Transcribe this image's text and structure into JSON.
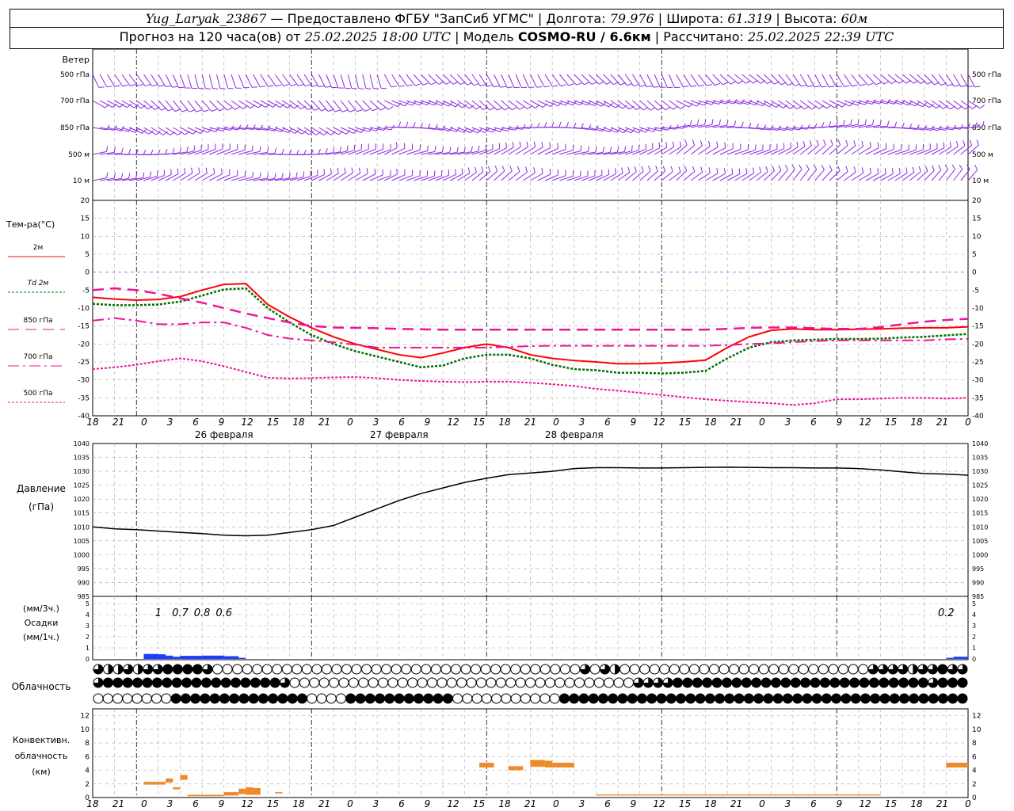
{
  "header": {
    "station": "Yug_Laryak_23867",
    "provider": "— Предоставлено ФГБУ \"ЗапСиб УГМС\"",
    "lon_label": "Долгота:",
    "lon": "79.976",
    "lat_label": "Широта:",
    "lat": "61.319",
    "alt_label": "Высота:",
    "alt": "60м",
    "forecast_label": "Прогноз на 120 часа(ов) от",
    "forecast_time": "25.02.2025 18:00 UTC",
    "model_label": "Модель",
    "model": "COSMO-RU / 6.6км",
    "calc_label": "Рассчитано:",
    "calc_time": "25.02.2025 22:39 UTC"
  },
  "labels": {
    "wind": "Ветер",
    "wind_levels": [
      "500 гПа",
      "700 гПа",
      "850 гПа",
      "500 м",
      "10 м"
    ],
    "temp_title": "Тем-ра(°С)",
    "legend": [
      {
        "label": "2м",
        "color": "#ff0000"
      },
      {
        "label": "Td 2м",
        "color": "#007000"
      },
      {
        "label": "850 гПа",
        "color": "#ee1493"
      },
      {
        "label": "700 гПа",
        "color": "#ee1493"
      },
      {
        "label": "500 гПа",
        "color": "#ee1493"
      }
    ],
    "pressure_title": "Давление",
    "pressure_unit": "(гПа)",
    "precip_unit_3h": "(мм/3ч.)",
    "precip_title": "Осадки",
    "precip_unit_1h": "(мм/1ч.)",
    "cloud_title": "Облачность",
    "conv_title1": "Конвективн.",
    "conv_title2": "облачность",
    "conv_unit": "(км)",
    "day_labels": [
      "26 февраля",
      "27 февраля",
      "28 февраля"
    ]
  },
  "chart_data": [
    {
      "type": "line",
      "title": "Тем-ра(°С)",
      "x_hours": [
        0,
        3,
        6,
        9,
        12,
        15,
        18,
        21,
        24,
        27,
        30,
        33,
        36,
        39,
        42,
        45,
        48,
        51,
        54,
        57,
        60,
        63,
        66,
        69,
        72,
        75,
        78,
        81,
        84,
        87,
        90,
        93,
        96,
        99,
        102,
        105,
        108,
        111,
        114,
        117,
        120
      ],
      "xticks": [
        "18",
        "21",
        "0",
        "3",
        "6",
        "9",
        "12",
        "15",
        "18",
        "21",
        "0",
        "3",
        "6",
        "9",
        "12",
        "15",
        "18",
        "21",
        "0",
        "3",
        "6",
        "9",
        "12",
        "15",
        "18",
        "21",
        "0",
        "3",
        "6",
        "9",
        "12",
        "15",
        "18",
        "21",
        "0"
      ],
      "ylim": [
        -40,
        20
      ],
      "yticks": [
        -40,
        -35,
        -30,
        -25,
        -20,
        -15,
        -10,
        -5,
        0,
        5,
        10,
        15,
        20
      ],
      "series": [
        {
          "name": "2м",
          "color": "#ff0000",
          "values": [
            -7,
            -7.5,
            -7.8,
            -7.6,
            -6.8,
            -5,
            -3.4,
            -3.2,
            -9,
            -12.5,
            -15.5,
            -18,
            -20,
            -21.5,
            -23,
            -23.8,
            -22.5,
            -21,
            -20,
            -21,
            -23,
            -24,
            -24.6,
            -25,
            -25.5,
            -25.5,
            -25.3,
            -25,
            -24.5,
            -21,
            -18,
            -16.2,
            -15.8,
            -16,
            -16,
            -15.9,
            -15.8,
            -15.6,
            -15.5,
            -15.5,
            -15.2
          ]
        },
        {
          "name": "Td 2м",
          "color": "#007000",
          "values": [
            -8.8,
            -9.2,
            -9.2,
            -9.0,
            -8.2,
            -6.5,
            -4.8,
            -4.5,
            -10,
            -14,
            -17.5,
            -20,
            -22,
            -23.5,
            -25,
            -26.5,
            -26,
            -24,
            -23,
            -23,
            -24,
            -25.8,
            -27,
            -27.3,
            -28,
            -28,
            -28.2,
            -28,
            -27.5,
            -24,
            -21,
            -19.5,
            -19,
            -18.8,
            -18.6,
            -18.6,
            -18.5,
            -18.2,
            -18,
            -17.6,
            -17.2
          ]
        },
        {
          "name": "850 гПа",
          "color": "#ee1493",
          "values": [
            -5,
            -4.5,
            -5,
            -6,
            -7.3,
            -8.5,
            -10,
            -11.5,
            -12.8,
            -14,
            -15,
            -15.4,
            -15.5,
            -15.6,
            -15.8,
            -15.9,
            -16,
            -16,
            -16,
            -16,
            -16,
            -16,
            -16,
            -16,
            -16,
            -16,
            -16,
            -16,
            -16,
            -15.8,
            -15.5,
            -15.4,
            -15.4,
            -15.6,
            -15.8,
            -15.8,
            -15.3,
            -14.5,
            -13.8,
            -13.3,
            -13
          ]
        },
        {
          "name": "700 гПа",
          "color": "#ee1493",
          "values": [
            -13.5,
            -12.8,
            -13.5,
            -14.5,
            -14.5,
            -14,
            -14,
            -15.5,
            -17.5,
            -18.5,
            -19,
            -19.5,
            -20.2,
            -21,
            -21,
            -21,
            -21,
            -21,
            -21,
            -20.8,
            -20.6,
            -20.5,
            -20.5,
            -20.5,
            -20.5,
            -20.5,
            -20.5,
            -20.5,
            -20.5,
            -20.3,
            -20,
            -19.8,
            -19.5,
            -19.2,
            -19,
            -19,
            -19,
            -19,
            -19,
            -18.7,
            -18.6
          ]
        },
        {
          "name": "500 гПа",
          "color": "#ee1493",
          "values": [
            -27,
            -26.5,
            -25.8,
            -24.8,
            -24,
            -24.8,
            -26.2,
            -27.8,
            -29.4,
            -29.6,
            -29.5,
            -29.3,
            -29.2,
            -29.5,
            -30,
            -30.3,
            -30.5,
            -30.6,
            -30.5,
            -30.5,
            -30.8,
            -31.2,
            -31.7,
            -32.5,
            -33,
            -33.6,
            -34.2,
            -34.8,
            -35.4,
            -35.8,
            -36.2,
            -36.5,
            -37,
            -36.5,
            -35.4,
            -35.4,
            -35.2,
            -35,
            -35,
            -35.2,
            -35
          ]
        }
      ]
    },
    {
      "type": "line",
      "title": "Давление",
      "ylabel": "(гПа)",
      "ylim": [
        985,
        1040
      ],
      "yticks": [
        985,
        990,
        995,
        1000,
        1005,
        1010,
        1015,
        1020,
        1025,
        1030,
        1035,
        1040
      ],
      "series": [
        {
          "name": "",
          "color": "#000000",
          "values": [
            1010,
            1009.3,
            1009,
            1008.5,
            1008,
            1007.6,
            1007,
            1006.8,
            1007,
            1008,
            1009,
            1010.5,
            1013.5,
            1016.5,
            1019.5,
            1022,
            1024,
            1026,
            1027.5,
            1028.8,
            1029.4,
            1030,
            1031,
            1031.3,
            1031.3,
            1031.2,
            1031.2,
            1031.3,
            1031.4,
            1031.5,
            1031.4,
            1031.3,
            1031.3,
            1031.2,
            1031.2,
            1031,
            1030.5,
            1029.8,
            1029.2,
            1029,
            1028.6
          ]
        }
      ]
    },
    {
      "type": "bar",
      "title": "Осадки",
      "ylim": [
        0,
        5
      ],
      "yticks": [
        0,
        1,
        2,
        3,
        4,
        5
      ],
      "labels_3h": [
        {
          "hour": 9,
          "text": "1"
        },
        {
          "hour": 12,
          "text": "0.7"
        },
        {
          "hour": 15,
          "text": "0.8"
        },
        {
          "hour": 18,
          "text": "0.6"
        },
        {
          "hour": 117,
          "text": "0.2"
        }
      ],
      "hourly": [
        {
          "from": 7,
          "to": 9,
          "value": 0.45
        },
        {
          "from": 9,
          "to": 10,
          "value": 0.42
        },
        {
          "from": 10,
          "to": 11,
          "value": 0.3
        },
        {
          "from": 11,
          "to": 12,
          "value": 0.2
        },
        {
          "from": 12,
          "to": 15,
          "value": 0.28
        },
        {
          "from": 15,
          "to": 18,
          "value": 0.3
        },
        {
          "from": 18,
          "to": 20,
          "value": 0.25
        },
        {
          "from": 20,
          "to": 21,
          "value": 0.1
        },
        {
          "from": 117,
          "to": 118,
          "value": 0.1
        },
        {
          "from": 118,
          "to": 120,
          "value": 0.2
        }
      ],
      "color": "#1e3cff"
    },
    {
      "type": "bar",
      "title": "Конвективн. облачность",
      "ylabel": "(км)",
      "ylim": [
        0,
        13
      ],
      "yticks": [
        0,
        2,
        4,
        6,
        8,
        10,
        12
      ],
      "color": "#f08a28",
      "segments": [
        {
          "from": 7,
          "to": 10,
          "base": 1.9,
          "top": 2.3
        },
        {
          "from": 10,
          "to": 11,
          "base": 2.2,
          "top": 2.8
        },
        {
          "from": 11,
          "to": 12,
          "base": 1.2,
          "top": 1.5
        },
        {
          "from": 12,
          "to": 13,
          "base": 2.6,
          "top": 3.3
        },
        {
          "from": 13,
          "to": 18,
          "base": 0.2,
          "top": 0.4
        },
        {
          "from": 18,
          "to": 20,
          "base": 0.3,
          "top": 0.8
        },
        {
          "from": 20,
          "to": 21,
          "base": 0.5,
          "top": 1.3
        },
        {
          "from": 21,
          "to": 22,
          "base": 0.4,
          "top": 1.5
        },
        {
          "from": 22,
          "to": 23,
          "base": 0.4,
          "top": 1.4
        },
        {
          "from": 25,
          "to": 26,
          "base": 0.6,
          "top": 0.8
        },
        {
          "from": 53,
          "to": 55,
          "base": 4.4,
          "top": 5.1
        },
        {
          "from": 57,
          "to": 59,
          "base": 4.0,
          "top": 4.6
        },
        {
          "from": 60,
          "to": 62,
          "base": 4.5,
          "top": 5.5
        },
        {
          "from": 62,
          "to": 63,
          "base": 4.4,
          "top": 5.4
        },
        {
          "from": 63,
          "to": 66,
          "base": 4.4,
          "top": 5.1
        },
        {
          "from": 69,
          "to": 108,
          "base": 0.3,
          "top": 0.45
        },
        {
          "from": 117,
          "to": 120,
          "base": 4.4,
          "top": 5.1
        }
      ]
    },
    {
      "type": "table",
      "title": "Облачность",
      "rows": [
        "qhhqhqqffffqoooooooooooooooooooooooooooooooooooooqoqhoooooooooooooooooooooooooqqqqhqqfqq",
        "qffffffffffffffffffqoooooooooooooooooooooooooooooooooooqqqqffffffffffffffffffffffffffqfff",
        "ooooooooffffffffffffffoooofffffffffffoooooooooooffffffffffffffffffffffffffffffffffffffffff"
      ]
    }
  ]
}
